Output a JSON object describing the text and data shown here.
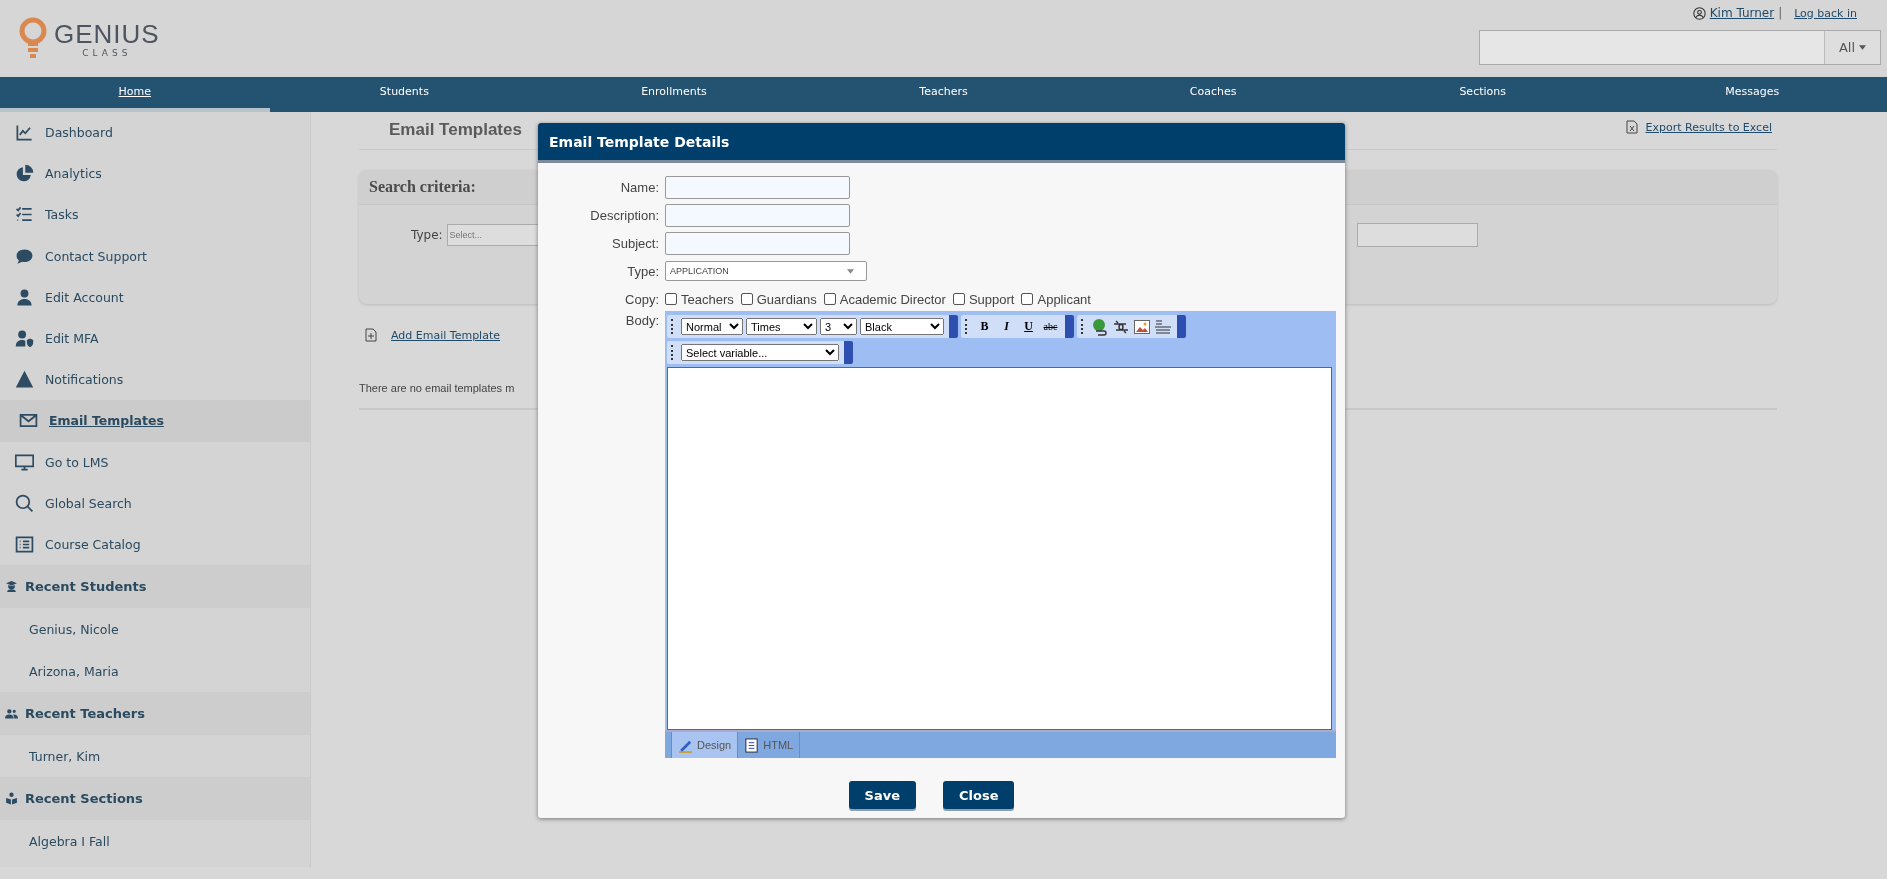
{
  "header": {
    "logo": {
      "name": "GENIUS",
      "tagline": "CLASS"
    },
    "user": {
      "name": "Kim Turner",
      "separator": "|",
      "logout": "Log back in"
    },
    "search": {
      "scope": "All"
    }
  },
  "nav": {
    "tabs": [
      {
        "label": "Home",
        "selected": true
      },
      {
        "label": "Students",
        "selected": false
      },
      {
        "label": "Enrollments",
        "selected": false
      },
      {
        "label": "Teachers",
        "selected": false
      },
      {
        "label": "Coaches",
        "selected": false
      },
      {
        "label": "Sections",
        "selected": false
      },
      {
        "label": "Messages",
        "selected": false
      }
    ]
  },
  "sidebar": {
    "items": [
      {
        "label": "Dashboard",
        "selected": false
      },
      {
        "label": "Analytics",
        "selected": false
      },
      {
        "label": "Tasks",
        "selected": false
      },
      {
        "label": "Contact Support",
        "selected": false
      },
      {
        "label": "Edit Account",
        "selected": false
      },
      {
        "label": "Edit MFA",
        "selected": false
      },
      {
        "label": "Notifications",
        "selected": false
      },
      {
        "label": "Email Templates",
        "selected": true
      },
      {
        "label": "Go to LMS",
        "selected": false
      },
      {
        "label": "Global Search",
        "selected": false
      },
      {
        "label": "Course Catalog",
        "selected": false
      }
    ],
    "sections": [
      {
        "title": "Recent Students",
        "items": [
          "Genius, Nicole",
          "Arizona, Maria"
        ]
      },
      {
        "title": "Recent Teachers",
        "items": [
          "Turner, Kim"
        ]
      },
      {
        "title": "Recent Sections",
        "items": [
          "Algebra I Fall"
        ]
      }
    ]
  },
  "page": {
    "title": "Email Templates",
    "export_link": "Export Results to Excel",
    "search": {
      "title": "Search criteria:",
      "type_label": "Type:",
      "type_placeholder": "Select..."
    },
    "add_link": "Add Email Template",
    "empty_message": "There are no email templates m"
  },
  "modal": {
    "title": "Email Template Details",
    "fields": [
      {
        "label": "Name:",
        "kind": "text"
      },
      {
        "label": "Description:",
        "kind": "text"
      },
      {
        "label": "Subject:",
        "kind": "text"
      },
      {
        "label": "Type:",
        "kind": "select",
        "value": "APPLICATION"
      }
    ],
    "copy": {
      "label": "Copy:",
      "options": [
        {
          "label": "Teachers",
          "checked": false
        },
        {
          "label": "Guardians",
          "checked": false
        },
        {
          "label": "Academic Director",
          "checked": false
        },
        {
          "label": "Support",
          "checked": false
        },
        {
          "label": "Applicant",
          "checked": false
        }
      ]
    },
    "body": {
      "label": "Body:",
      "selects": [
        "Normal",
        "Times",
        "3",
        "Black"
      ],
      "format_buttons": [
        {
          "label": "B",
          "kind": "bold"
        },
        {
          "label": "I",
          "kind": "italic"
        },
        {
          "label": "U",
          "kind": "underline"
        },
        {
          "label": "abc",
          "kind": "strike"
        }
      ],
      "variable_select": "Select variable...",
      "tabs": [
        {
          "label": "Design",
          "selected": true
        },
        {
          "label": "HTML",
          "selected": false
        }
      ]
    },
    "buttons": [
      "Save",
      "Close"
    ]
  }
}
